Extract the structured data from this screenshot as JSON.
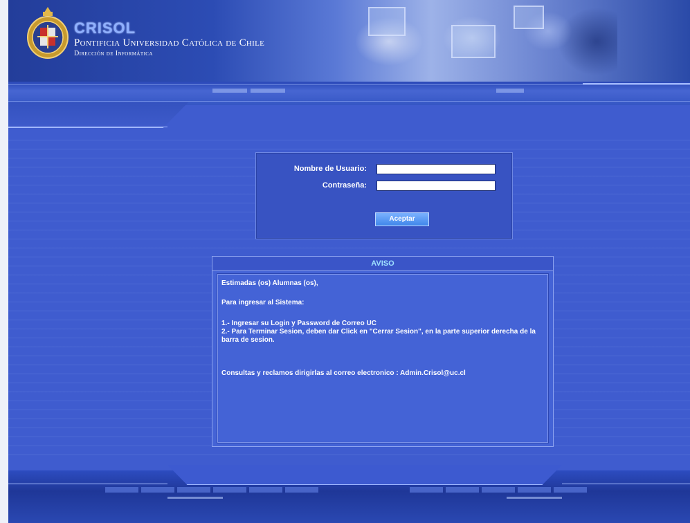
{
  "header": {
    "brand": "CRISOL",
    "university": "Pontificia Universidad Católica de Chile",
    "department": "Dirección de Informática"
  },
  "login": {
    "username_label": "Nombre de Usuario:",
    "username_value": "",
    "password_label": "Contraseña:",
    "password_value": "",
    "submit_label": "Aceptar"
  },
  "notice": {
    "title": "AVISO",
    "greeting": "Estimadas (os) Alumnas (os),",
    "intro": "Para ingresar al Sistema:",
    "step1": "1.- Ingresar su Login y Password de Correo UC",
    "step2": "2.- Para Terminar Sesion, deben dar Click en \"Cerrar Sesion\", en la parte superior derecha de la barra de sesion.",
    "contact": "Consultas y reclamos dirigirlas al correo electronico : Admin.Crisol@uc.cl"
  },
  "colors": {
    "background": "#3f5ccf",
    "header_dark": "#233d9a",
    "notice_title": "#9ee0ff",
    "button": "#3f86ea"
  }
}
